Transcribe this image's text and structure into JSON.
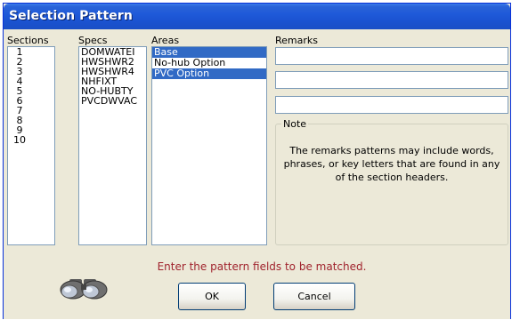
{
  "window": {
    "title": "Selection Pattern"
  },
  "labels": {
    "sections": "Sections",
    "specs": "Specs",
    "areas": "Areas",
    "remarks": "Remarks"
  },
  "sections": [
    "1",
    "2",
    "3",
    "4",
    "5",
    "6",
    "7",
    "8",
    "9",
    "10"
  ],
  "specs": [
    "DOMWATEI",
    "HWSHWR2",
    "HWSHWR4",
    "NHFIXT",
    "NO-HUBTY",
    "PVCDWVAC"
  ],
  "areas": [
    {
      "label": "Base",
      "selected": true
    },
    {
      "label": "No-hub Option",
      "selected": false
    },
    {
      "label": "PVC Option",
      "selected": true
    }
  ],
  "remarks": {
    "field1": "",
    "field2": "",
    "field3": ""
  },
  "note": {
    "legend": "Note",
    "text": "The remarks patterns may include words, phrases, or key letters that are found in any of the section headers."
  },
  "message": "Enter the pattern fields to be matched.",
  "buttons": {
    "ok": "OK",
    "cancel": "Cancel"
  },
  "icons": {
    "find": "binoculars-icon"
  },
  "colors": {
    "selection": "#316ac5",
    "message": "#a0232d",
    "titlebar": "#1f5ad9"
  }
}
